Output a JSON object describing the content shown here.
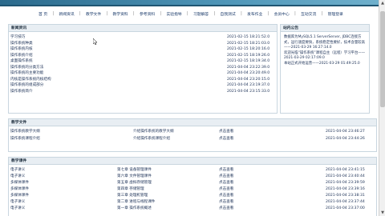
{
  "nav": [
    "首 页",
    "新闻资讯",
    "教学文件",
    "教学资料",
    "参考资料",
    "实验指导",
    "习题解答",
    "自我测试",
    "发布作业",
    "会员中心",
    "互动交流",
    "管理登录"
  ],
  "news": {
    "title": "新闻资讯",
    "items": [
      {
        "label": "学习技巧",
        "date": "2021-02-15 18:21:52.0"
      },
      {
        "label": "操作系统种类",
        "date": "2021-02-15 18:21:03.0"
      },
      {
        "label": "操作系统内核",
        "date": "2021-02-15 18:20:16.0"
      },
      {
        "label": "操作系统介绍",
        "date": "2021-02-15 18:19:26.0"
      },
      {
        "label": "桌面操作系统",
        "date": "2021-02-15 18:19:34.0"
      },
      {
        "label": "操作系统的分类方法",
        "date": "2021-04-04 23:22:39.0"
      },
      {
        "label": "操作系统的主要功能",
        "date": "2021-04-04 23:20:49.0"
      },
      {
        "label": "内核是操作系统内核结构",
        "date": "2021-04-04 23:20:15.0"
      },
      {
        "label": "操作系统的组成部分",
        "date": "2021-04-04 23:19:37.0"
      },
      {
        "label": "操作系统简介",
        "date": "2021-04-04 23:15:33.0"
      }
    ]
  },
  "notice": {
    "title": "站内公告",
    "text": "数据库为MySQL5.1 ServerServer, JDBC连接方式，运行速度要快，系统稳定性要好，技术含量较高——2021-03-29 16:27:14.0\n欢迎光临“操作系统”课程自主（远程）学习平台——2021-03-29 02:17:09.0\n本站正式开始运营——2021-03-29 01:49:25.0"
  },
  "files": {
    "title": "教学文件",
    "items": [
      {
        "name": "操作系统教学大纲",
        "desc": "介绍操作系统的教学大纲",
        "action": "点击查看",
        "date": "2021-04-04 23:46:27"
      },
      {
        "name": "操作系统课程介绍",
        "desc": "介绍操作系统课程介绍",
        "action": "点击查看",
        "date": "2021-04-04 23:44:26"
      }
    ]
  },
  "courseware": {
    "title": "教学课件",
    "items": [
      {
        "type": "电子讲义",
        "chapter": "第七章 设备管理课件",
        "action": "点击查看",
        "date": "2021-04-04 23:41:15"
      },
      {
        "type": "电子讲义",
        "chapter": "第六章 文件管理课件",
        "action": "点击查看",
        "date": "2021-04-04 23:40:44"
      },
      {
        "type": "多媒体课件",
        "chapter": "第五章 虚拟存储管理",
        "action": "点击查看",
        "date": "2021-04-04 23:39:59"
      },
      {
        "type": "多媒体课件",
        "chapter": "第四章 存储管理",
        "action": "点击查看",
        "date": "2021-04-04 23:39:16"
      },
      {
        "type": "多媒体课件",
        "chapter": "第三章 处理机管理",
        "action": "点击查看",
        "date": "2021-04-04 23:38:31"
      },
      {
        "type": "电子讲义",
        "chapter": "第二章 进程与线程课件",
        "action": "点击查看",
        "date": "2021-04-04 23:37:44"
      },
      {
        "type": "电子讲义",
        "chapter": "第一章 操作系统概述",
        "action": "点击查看",
        "date": "2021-04-04 23:37:00"
      }
    ]
  }
}
